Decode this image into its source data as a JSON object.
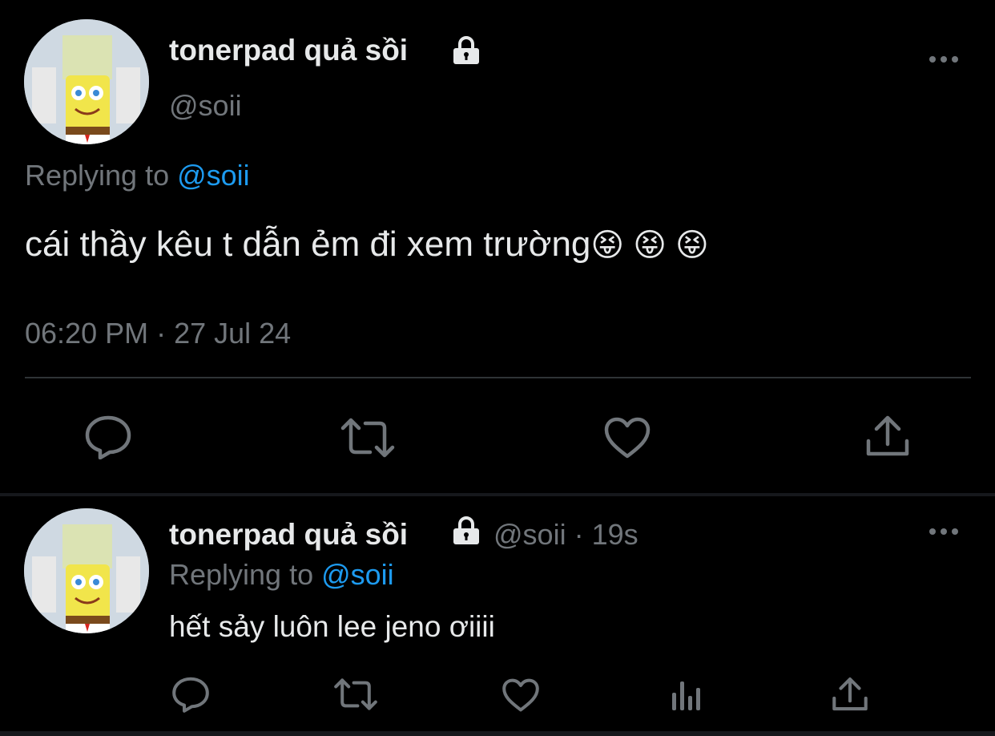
{
  "tweet_main": {
    "display_name": "tonerpad quả sồi",
    "handle": "@soii",
    "replying_prefix": "Replying to ",
    "replying_handle": "@soii",
    "text": "cái thầy kêu t dẫn ẻm đi xem trường",
    "emojis": "😝 😝 😝",
    "timestamp": "06:20 PM · 27 Jul 24"
  },
  "tweet_reply": {
    "display_name": "tonerpad quả sồi",
    "handle": "@soii",
    "separator": " · ",
    "time_ago": "19s",
    "replying_prefix": "Replying to ",
    "replying_handle": "@soii",
    "text": "hết sảy luôn lee jeno ơiiii"
  },
  "icons": {
    "lock": "lock-icon",
    "more": "more-icon",
    "reply": "reply-icon",
    "retweet": "retweet-icon",
    "like": "heart-icon",
    "share": "share-icon",
    "views": "views-icon"
  },
  "colors": {
    "background": "#000000",
    "text": "#e7e9ea",
    "muted": "#71767b",
    "accent": "#1d9bf0"
  }
}
